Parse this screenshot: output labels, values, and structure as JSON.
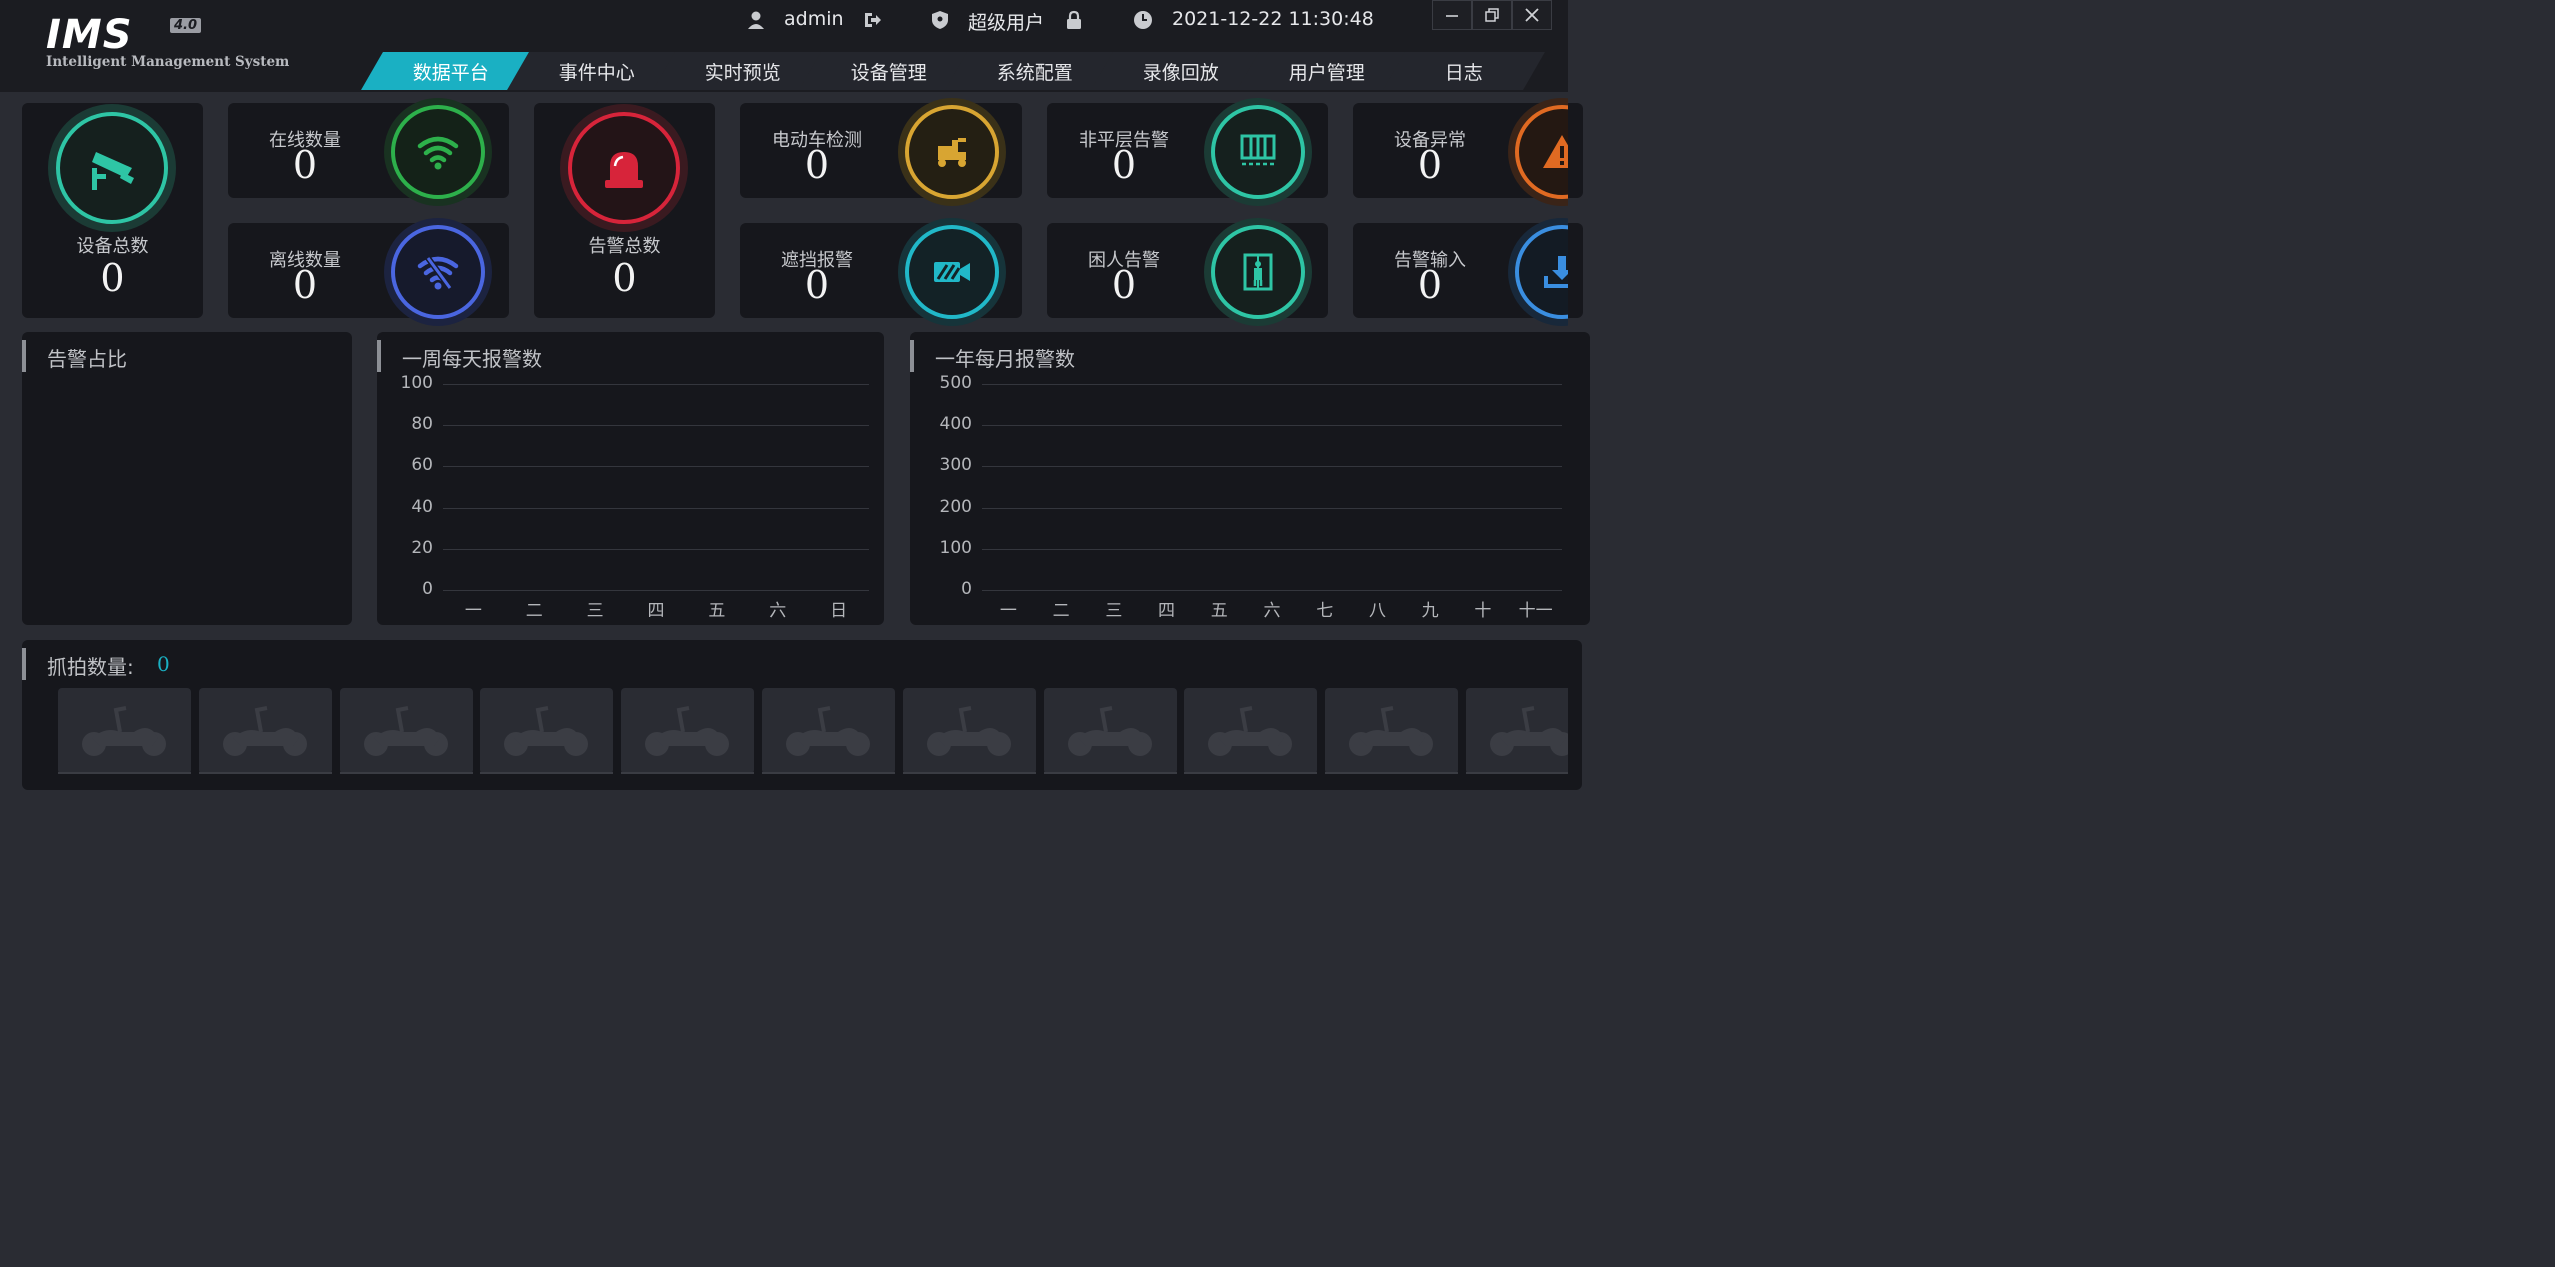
{
  "header": {
    "logo": "IMS",
    "logo_version": "4.0",
    "logo_subtitle": "Intelligent Management System",
    "username": "admin",
    "role": "超级用户",
    "datetime": "2021-12-22 11:30:48"
  },
  "nav": {
    "tabs": [
      {
        "label": "数据平台",
        "active": true
      },
      {
        "label": "事件中心",
        "active": false
      },
      {
        "label": "实时预览",
        "active": false
      },
      {
        "label": "设备管理",
        "active": false
      },
      {
        "label": "系统配置",
        "active": false
      },
      {
        "label": "录像回放",
        "active": false
      },
      {
        "label": "用户管理",
        "active": false
      },
      {
        "label": "日志",
        "active": false
      }
    ]
  },
  "stats": {
    "device_total": {
      "label": "设备总数",
      "value": "0",
      "icon": "camera-icon",
      "color": "#2ec5a5"
    },
    "online": {
      "label": "在线数量",
      "value": "0",
      "icon": "wifi-icon",
      "color": "#2db04b"
    },
    "offline": {
      "label": "离线数量",
      "value": "0",
      "icon": "wifi-off-icon",
      "color": "#4a66e0"
    },
    "alarm_total": {
      "label": "告警总数",
      "value": "0",
      "icon": "siren-icon",
      "color": "#d7243a"
    },
    "ebike": {
      "label": "电动车检测",
      "value": "0",
      "icon": "ebike-icon",
      "color": "#d8a532"
    },
    "occlusion": {
      "label": "遮挡报警",
      "value": "0",
      "icon": "camera-blocked-icon",
      "color": "#21b8c8"
    },
    "non_level": {
      "label": "非平层告警",
      "value": "0",
      "icon": "elevator-door-icon",
      "color": "#2ec5a5"
    },
    "trapped": {
      "label": "困人告警",
      "value": "0",
      "icon": "elevator-person-icon",
      "color": "#2ec5a5"
    },
    "device_error": {
      "label": "设备异常",
      "value": "0",
      "icon": "warning-icon",
      "color": "#e06a22"
    },
    "alarm_input": {
      "label": "告警输入",
      "value": "0",
      "icon": "download-icon",
      "color": "#3a8ee0"
    }
  },
  "panels": {
    "ratio_title": "告警占比",
    "weekly_title": "一周每天报警数",
    "monthly_title": "一年每月报警数",
    "capture_label": "抓拍数量:",
    "capture_count": "0"
  },
  "chart_data": [
    {
      "type": "bar",
      "title": "一周每天报警数",
      "categories": [
        "一",
        "二",
        "三",
        "四",
        "五",
        "六",
        "日"
      ],
      "values": [
        0,
        0,
        0,
        0,
        0,
        0,
        0
      ],
      "ylim": [
        0,
        100
      ],
      "yticks": [
        "100",
        "80",
        "60",
        "40",
        "20",
        "0"
      ],
      "grid": true
    },
    {
      "type": "bar",
      "title": "一年每月报警数",
      "categories": [
        "一",
        "二",
        "三",
        "四",
        "五",
        "六",
        "七",
        "八",
        "九",
        "十",
        "十一"
      ],
      "values": [
        0,
        0,
        0,
        0,
        0,
        0,
        0,
        0,
        0,
        0,
        0
      ],
      "ylim": [
        0,
        500
      ],
      "yticks": [
        "500",
        "400",
        "300",
        "200",
        "100",
        "0"
      ],
      "grid": true
    }
  ],
  "captures": {
    "placeholder_icon": "scooter-icon",
    "count_visible": 11
  },
  "colors": {
    "accent": "#1ab0c3",
    "background": "#2a2c33",
    "card": "#16171c"
  }
}
